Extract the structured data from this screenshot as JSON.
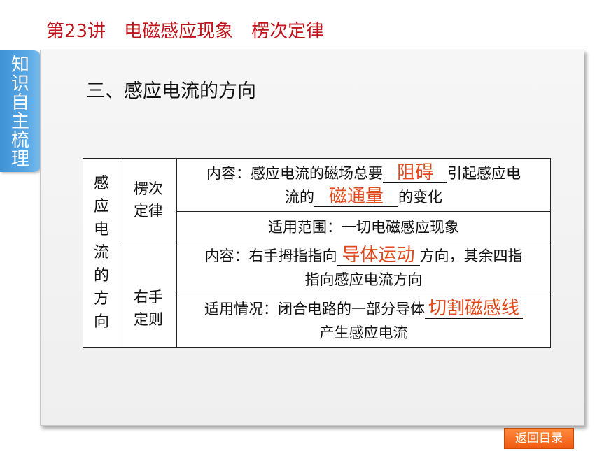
{
  "header": {
    "title": "第23讲　电磁感应现象　楞次定律"
  },
  "side_tab": {
    "label": "知识自主梳理"
  },
  "section": {
    "heading": "三、感应电流的方向"
  },
  "table": {
    "category": "感应电流的方向",
    "lenz": {
      "name": "楞次定律",
      "content_prefix": "内容：感应电流的磁场总要",
      "blank1": "阻碍",
      "content_mid": "引起感应电",
      "content_line2_prefix": "流的",
      "blank2": "磁通量",
      "content_suffix": "的变化",
      "scope": "适用范围：一切电磁感应现象"
    },
    "right_hand": {
      "name": "右手定则",
      "content_prefix": "内容：右手拇指指向",
      "blank1": "导体运动",
      "content_mid": "方向，其余四指",
      "content_line2": "指向感应电流方向",
      "situation_prefix": "适用情况：闭合电路的一部分导体",
      "blank2": "切割磁感线",
      "situation_line2": "产生感应电流"
    }
  },
  "footer": {
    "return_label": "返回目录"
  }
}
